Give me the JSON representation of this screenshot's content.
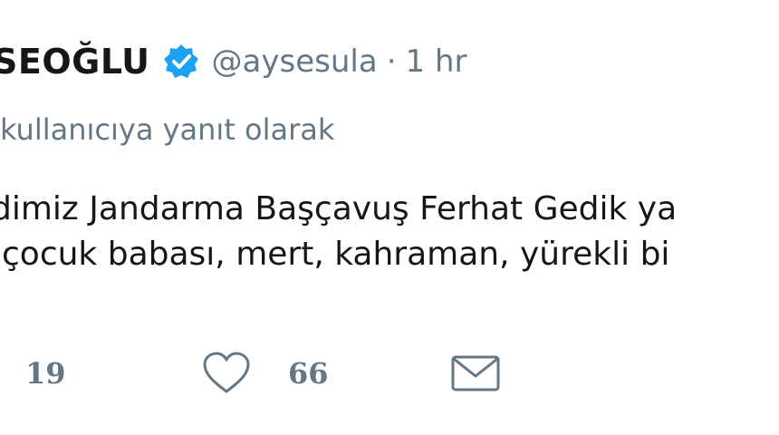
{
  "tweet": {
    "display_name": "SEOĞLU",
    "handle": "@aysesula",
    "separator": "·",
    "time": "1 hr",
    "reply_to": "kullanıcıya yanıt olarak",
    "text_lines": [
      "dimiz Jandarma Başçavuş Ferhat Gedik ya",
      "çocuk babası, mert, kahraman, yürekli bi"
    ]
  },
  "actions": {
    "retweet_count": "19",
    "like_count": "66"
  },
  "colors": {
    "verified_badge": "#1da1f2",
    "muted_text": "#657786",
    "main_text": "#14171a"
  }
}
